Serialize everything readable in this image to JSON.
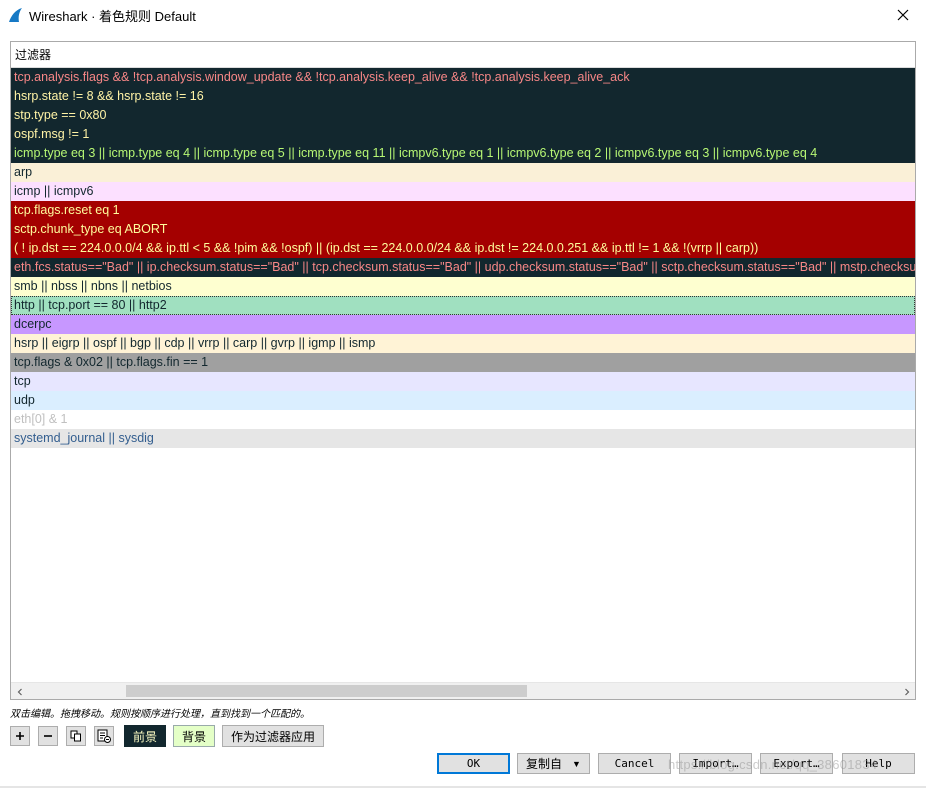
{
  "window": {
    "title": "Wireshark · 着色规则 Default"
  },
  "list": {
    "header": "过滤器",
    "rules": [
      {
        "filter": "tcp.analysis.flags && !tcp.analysis.window_update && !tcp.analysis.keep_alive && !tcp.analysis.keep_alive_ack",
        "fg": "#f78787",
        "bg": "#12272e"
      },
      {
        "filter": "hsrp.state != 8 && hsrp.state != 16",
        "fg": "#fff3a6",
        "bg": "#12272e"
      },
      {
        "filter": "stp.type == 0x80",
        "fg": "#fff3a6",
        "bg": "#12272e"
      },
      {
        "filter": "ospf.msg != 1",
        "fg": "#fff3a6",
        "bg": "#12272e"
      },
      {
        "filter": "icmp.type eq 3 || icmp.type eq 4 || icmp.type eq 5 || icmp.type eq 11 || icmpv6.type eq 1 || icmpv6.type eq 2 || icmpv6.type eq 3 || icmpv6.type eq 4",
        "fg": "#b7f774",
        "bg": "#12272e"
      },
      {
        "filter": "arp",
        "fg": "#12272e",
        "bg": "#faf0d7"
      },
      {
        "filter": "icmp || icmpv6",
        "fg": "#12272e",
        "bg": "#fce0ff"
      },
      {
        "filter": "tcp.flags.reset eq 1",
        "fg": "#fffc9c",
        "bg": "#a40000"
      },
      {
        "filter": "sctp.chunk_type eq ABORT",
        "fg": "#fffc9c",
        "bg": "#a40000"
      },
      {
        "filter": "( ! ip.dst == 224.0.0.0/4 && ip.ttl < 5 && !pim && !ospf) || (ip.dst == 224.0.0.0/24 && ip.dst != 224.0.0.251 && ip.ttl != 1 && !(vrrp || carp))",
        "fg": "#fffc9c",
        "bg": "#a40000"
      },
      {
        "filter": "eth.fcs.status==\"Bad\" || ip.checksum.status==\"Bad\" || tcp.checksum.status==\"Bad\" || udp.checksum.status==\"Bad\" || sctp.checksum.status==\"Bad\" || mstp.checksum.status==\"Bad\"",
        "fg": "#f78787",
        "bg": "#12272e"
      },
      {
        "filter": "smb || nbss || nbns || netbios",
        "fg": "#12272e",
        "bg": "#feffd0"
      },
      {
        "filter": "http || tcp.port == 80 || http2",
        "fg": "#12272e",
        "bg": "#a0e0c0"
      },
      {
        "filter": "dcerpc",
        "fg": "#12272e",
        "bg": "#c797ff"
      },
      {
        "filter": "hsrp || eigrp || ospf || bgp || cdp || vrrp || carp || gvrp || igmp || ismp",
        "fg": "#12272e",
        "bg": "#fff3d6"
      },
      {
        "filter": "tcp.flags & 0x02 || tcp.flags.fin == 1",
        "fg": "#12272e",
        "bg": "#a0a0a0"
      },
      {
        "filter": "tcp",
        "fg": "#12272e",
        "bg": "#e7e6ff"
      },
      {
        "filter": "udp",
        "fg": "#12272e",
        "bg": "#daeeff"
      },
      {
        "filter": "eth[0] & 1",
        "fg": "#c0c0c0",
        "bg": "#ffffff"
      },
      {
        "filter": "systemd_journal || sysdig",
        "fg": "#335e8f",
        "bg": "#e6e6e6"
      }
    ]
  },
  "hint": "双击编辑。拖拽移动。规则按顺序进行处理，直到找到一个匹配的。",
  "toolbar": {
    "foreground_label": "前景",
    "background_label": "背景",
    "apply_label": "作为过滤器应用"
  },
  "buttons": {
    "ok": "OK",
    "copy_from": "复制自",
    "cancel": "Cancel",
    "import": "Import…",
    "export": "Export…",
    "help": "Help"
  },
  "watermark": "https://blog.csdn.net/qq_38601834"
}
